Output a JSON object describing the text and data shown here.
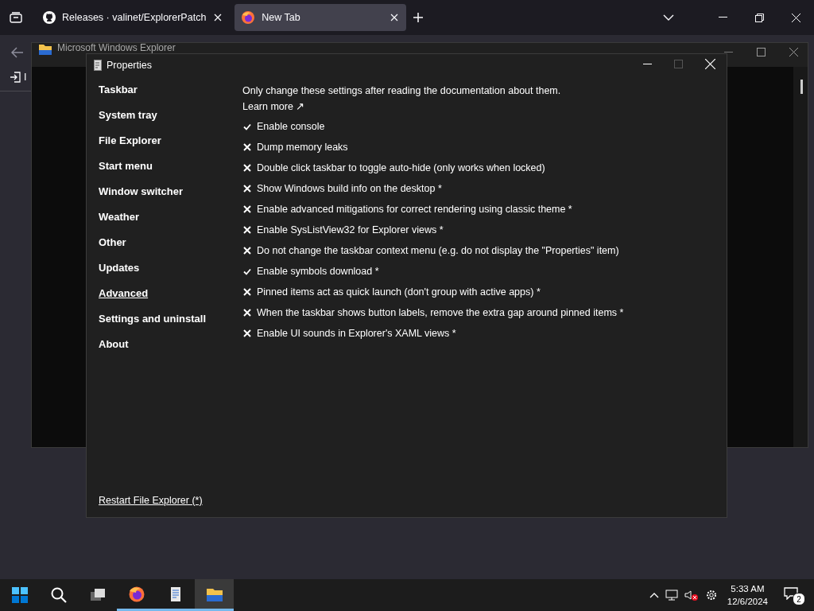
{
  "browser": {
    "tabs": [
      {
        "title": "Releases · valinet/ExplorerPatch",
        "selected": false
      },
      {
        "title": "New Tab",
        "selected": true
      }
    ],
    "bookmark": "I"
  },
  "explorer_window": {
    "title": "Microsoft Windows Explorer"
  },
  "properties": {
    "title": "Properties",
    "nav": [
      {
        "label": "Taskbar",
        "selected": false
      },
      {
        "label": "System tray",
        "selected": false
      },
      {
        "label": "File Explorer",
        "selected": false
      },
      {
        "label": "Start menu",
        "selected": false
      },
      {
        "label": "Window switcher",
        "selected": false
      },
      {
        "label": "Weather",
        "selected": false
      },
      {
        "label": "Other",
        "selected": false
      },
      {
        "label": "Updates",
        "selected": false
      },
      {
        "label": "Advanced",
        "selected": true
      },
      {
        "label": "Settings and uninstall",
        "selected": false
      },
      {
        "label": "About",
        "selected": false
      }
    ],
    "intro": "Only change these settings after reading the documentation about them.",
    "learn_more": "Learn more ↗",
    "options": [
      {
        "label": "Enable console",
        "checked": true
      },
      {
        "label": "Dump memory leaks",
        "checked": false
      },
      {
        "label": "Double click taskbar to toggle auto-hide (only works when locked)",
        "checked": false
      },
      {
        "label": "Show Windows build info on the desktop *",
        "checked": false
      },
      {
        "label": "Enable advanced mitigations for correct rendering using classic theme *",
        "checked": false
      },
      {
        "label": "Enable SysListView32 for Explorer views *",
        "checked": false
      },
      {
        "label": "Do not change the taskbar context menu (e.g. do not display the \"Properties\" item)",
        "checked": false
      },
      {
        "label": "Enable symbols download *",
        "checked": true
      },
      {
        "label": "Pinned items act as quick launch (don't group with active apps) *",
        "checked": false
      },
      {
        "label": "When the taskbar shows button labels, remove the extra gap around pinned items *",
        "checked": false
      },
      {
        "label": "Enable UI sounds in Explorer's XAML views *",
        "checked": false
      }
    ],
    "restart_link": "Restart File Explorer (*)"
  },
  "taskbar": {
    "apps": [
      {
        "kind": "start",
        "running": false,
        "selected": false
      },
      {
        "kind": "search",
        "running": false,
        "selected": false
      },
      {
        "kind": "taskview",
        "running": false,
        "selected": false
      },
      {
        "kind": "firefox",
        "running": true,
        "selected": false
      },
      {
        "kind": "document",
        "running": true,
        "selected": false
      },
      {
        "kind": "folder",
        "running": true,
        "selected": true
      }
    ],
    "time": "5:33 AM",
    "date": "12/6/2024",
    "notifications": "2"
  }
}
